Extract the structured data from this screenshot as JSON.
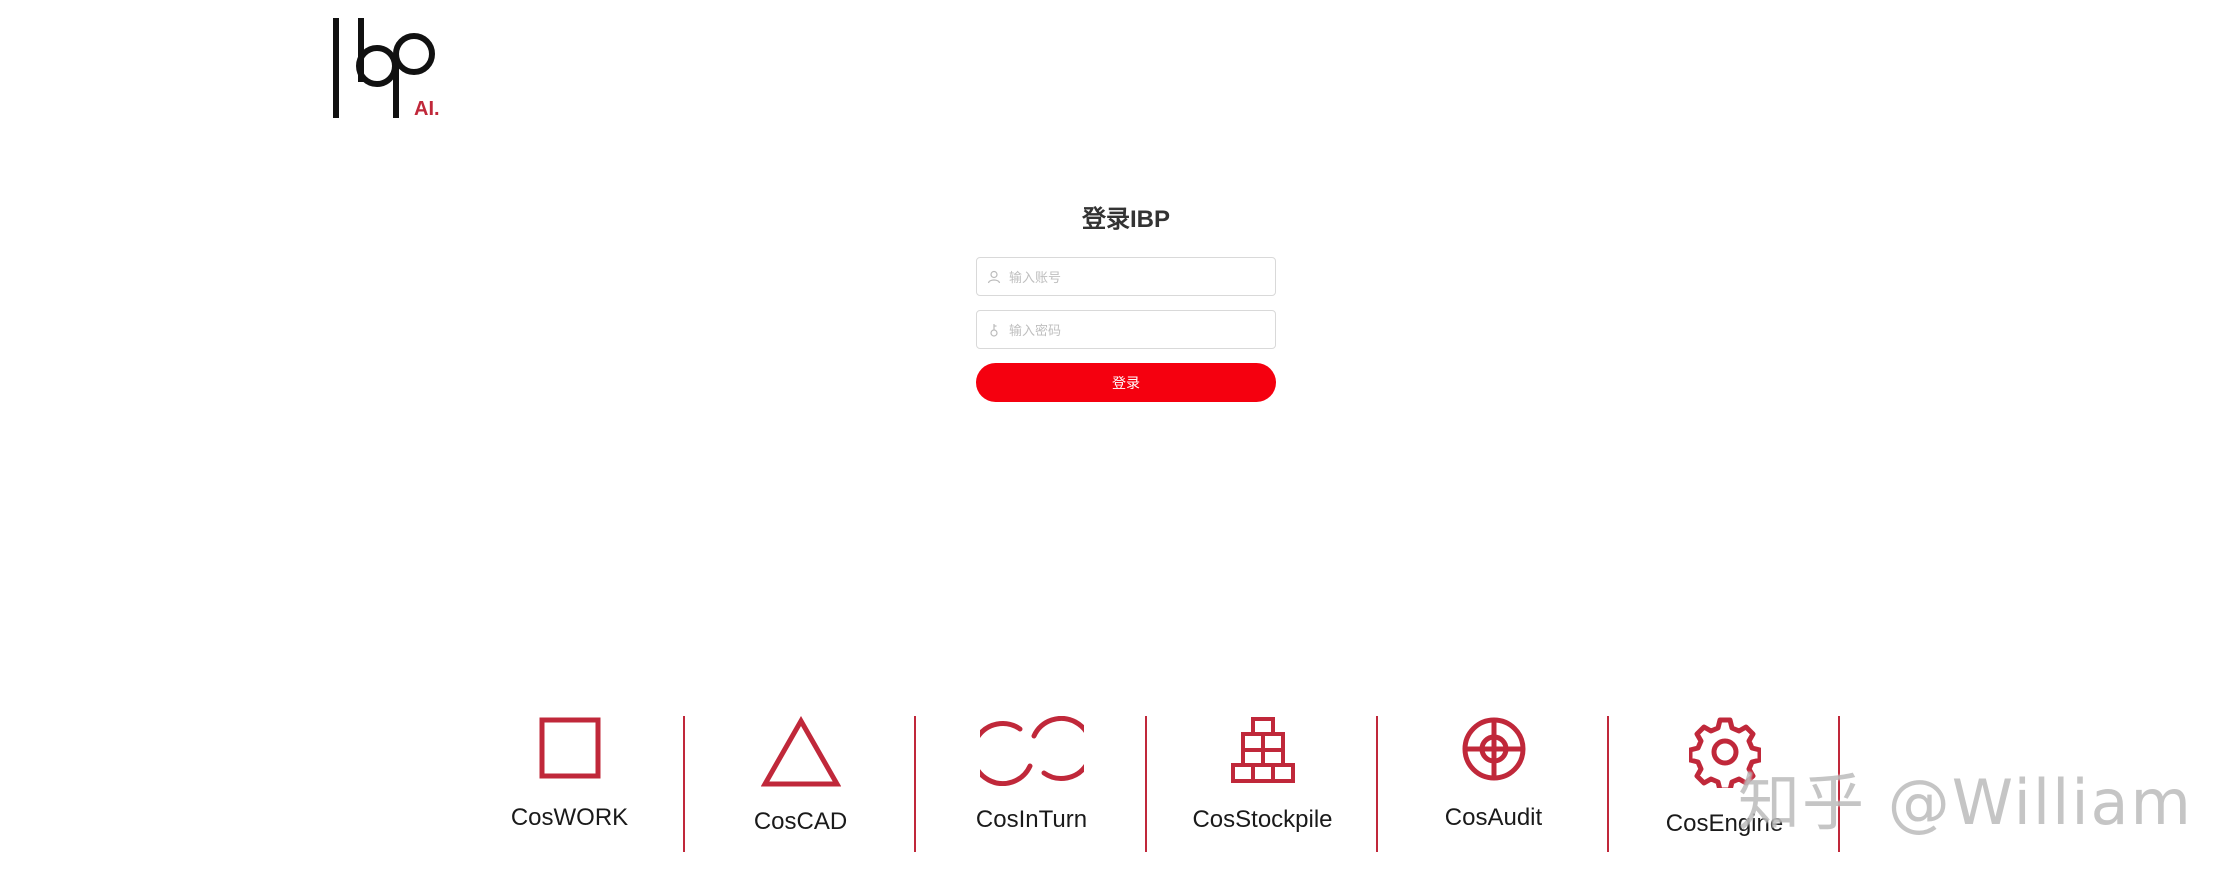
{
  "brand": {
    "logo_letters": "lbp",
    "logo_suffix": "AI."
  },
  "login": {
    "title": "登录IBP",
    "account_placeholder": "输入账号",
    "password_placeholder": "输入密码",
    "submit_label": "登录"
  },
  "products": [
    {
      "label": "CosWORK",
      "icon": "square-icon"
    },
    {
      "label": "CosCAD",
      "icon": "triangle-icon"
    },
    {
      "label": "CosInTurn",
      "icon": "linked-circles-icon"
    },
    {
      "label": "CosStockpile",
      "icon": "stacked-blocks-icon"
    },
    {
      "label": "CosAudit",
      "icon": "target-icon"
    },
    {
      "label": "CosEngine",
      "icon": "gear-icon"
    }
  ],
  "watermark": "知乎 @William",
  "colors": {
    "brand_red": "#c0283a",
    "button_red": "#f5000f"
  }
}
